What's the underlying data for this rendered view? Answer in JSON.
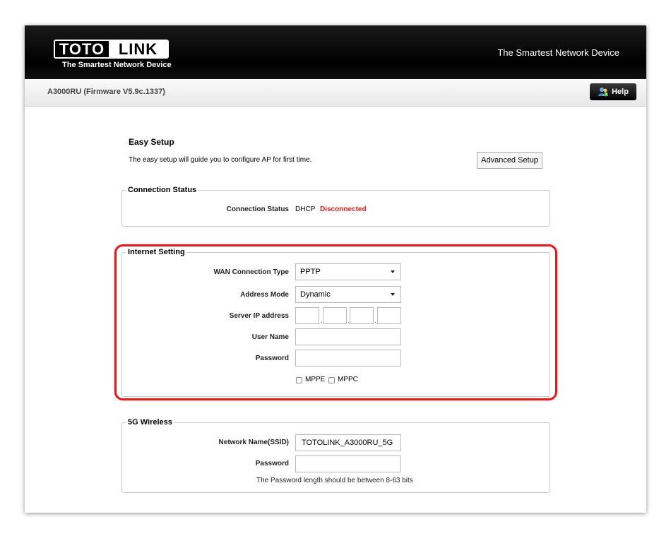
{
  "header": {
    "logo_left": "TOTO",
    "logo_right": "LINK",
    "logo_tagline": "The Smartest Network Device",
    "slogan": "The Smartest Network Device"
  },
  "subheader": {
    "firmware": "A3000RU (Firmware V5.9c.1337)",
    "help_label": "Help"
  },
  "easy_setup": {
    "title": "Easy Setup",
    "description": "The easy setup will guide you to configure AP for first time.",
    "advanced_button": "Advanced Setup"
  },
  "connection_status": {
    "legend": "Connection Status",
    "label": "Connection Status",
    "protocol": "DHCP",
    "state": "Disconnected",
    "state_color": "#e0201b"
  },
  "internet_setting": {
    "legend": "Internet Setting",
    "wan_label": "WAN Connection Type",
    "wan_value": "PPTP",
    "address_mode_label": "Address Mode",
    "address_mode_value": "Dynamic",
    "server_ip_label": "Server IP address",
    "server_ip": [
      "",
      "",
      "",
      ""
    ],
    "username_label": "User Name",
    "username_value": "",
    "password_label": "Password",
    "password_value": "",
    "mppe_label": "MPPE",
    "mppc_label": "MPPC",
    "mppe_checked": false,
    "mppc_checked": false,
    "highlight_color": "#e01b1b"
  },
  "wireless_5g": {
    "legend": "5G Wireless",
    "ssid_label": "Network Name(SSID)",
    "ssid_value": "TOTOLINK_A3000RU_5G",
    "password_label": "Password",
    "password_value": "",
    "note": "The Password length should be between 8-63 bits"
  }
}
